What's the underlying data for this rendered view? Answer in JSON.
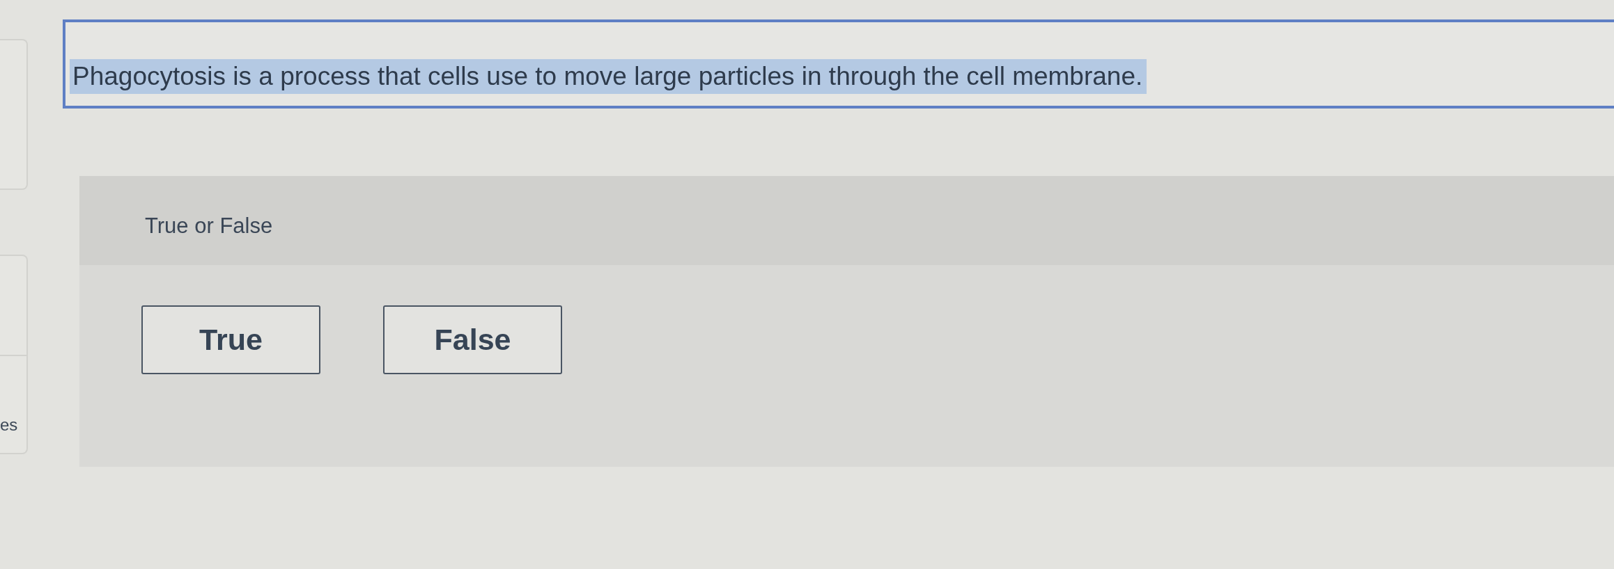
{
  "sidebar": {
    "label": "es"
  },
  "question": {
    "prompt": "Phagocytosis is a process that cells use to move large particles in through the cell membrane.",
    "highlighted": true
  },
  "answer": {
    "type_label": "True or False",
    "options": [
      {
        "label": "True",
        "selected": false
      },
      {
        "label": "False",
        "selected": false
      }
    ]
  }
}
